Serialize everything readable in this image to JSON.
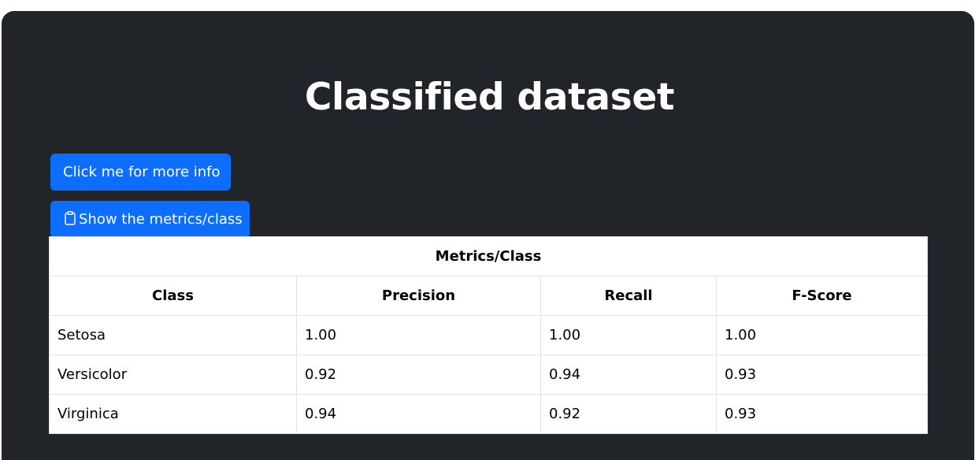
{
  "page": {
    "title": "Classified dataset"
  },
  "buttons": {
    "info_label": "Click me for more info",
    "metrics_label": "Show the metrics/class",
    "metrics_icon": "clipboard-icon"
  },
  "table": {
    "caption": "Metrics/Class",
    "headers": [
      "Class",
      "Precision",
      "Recall",
      "F-Score"
    ],
    "rows": [
      [
        "Setosa",
        "1.00",
        "1.00",
        "1.00"
      ],
      [
        "Versicolor",
        "0.92",
        "0.94",
        "0.93"
      ],
      [
        "Virginica",
        "0.94",
        "0.92",
        "0.93"
      ]
    ]
  },
  "colors": {
    "panel_bg": "#212529",
    "button_bg": "#0d6efd",
    "table_border": "#dee2e6"
  }
}
